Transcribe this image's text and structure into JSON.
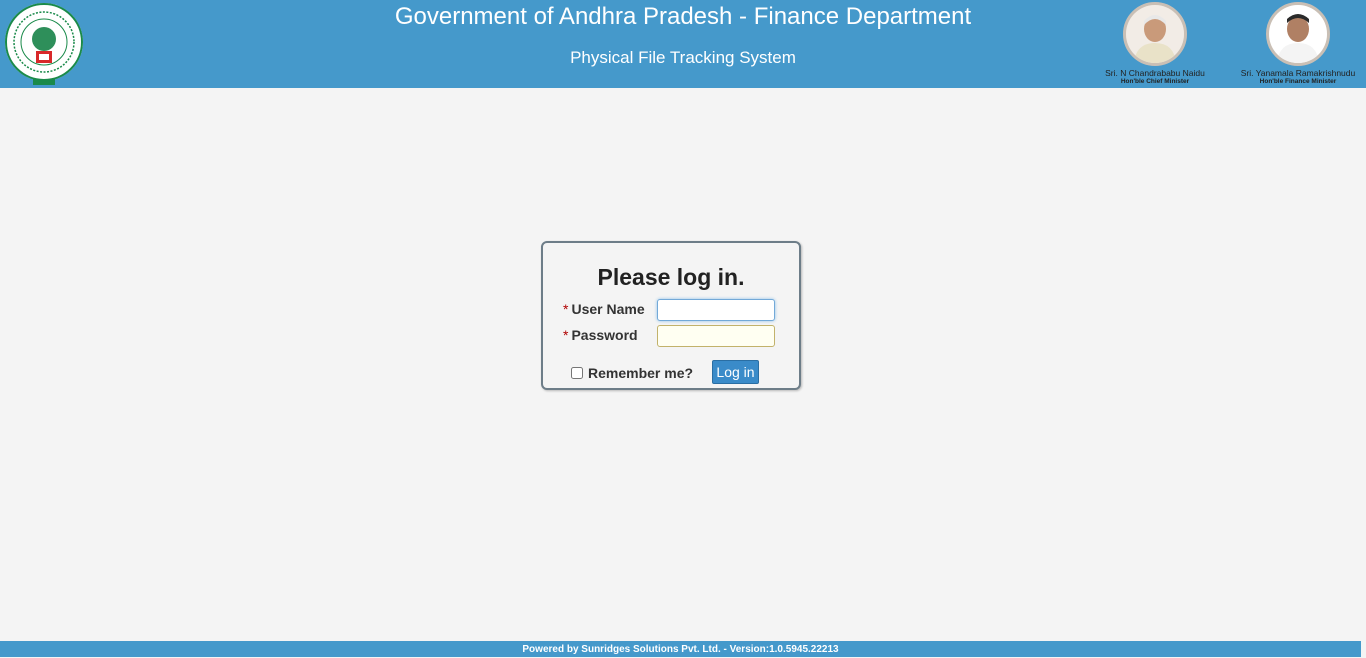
{
  "header": {
    "title": "Government of Andhra Pradesh - Finance Department",
    "subtitle": "Physical File Tracking System",
    "dignitaries": [
      {
        "name": "Sri. N Chandrababu Naidu",
        "role": "Hon'ble Chief Minister"
      },
      {
        "name": "Sri. Yanamala Ramakrishnudu",
        "role": "Hon'ble Finance Minister"
      }
    ]
  },
  "login": {
    "title": "Please log in.",
    "required_marker": "*",
    "username_label": "User Name",
    "password_label": "Password",
    "username_value": "",
    "password_value": "",
    "remember_label": "Remember me?",
    "remember_checked": false,
    "submit_label": "Log in"
  },
  "footer": {
    "text": "Powered by Sunridges Solutions Pvt. Ltd. - Version:1.0.5945.22213"
  },
  "colors": {
    "header_bg": "#4599cb",
    "page_bg": "#f4f4f4",
    "button_bg": "#3a8bc9",
    "required": "#b00000"
  }
}
